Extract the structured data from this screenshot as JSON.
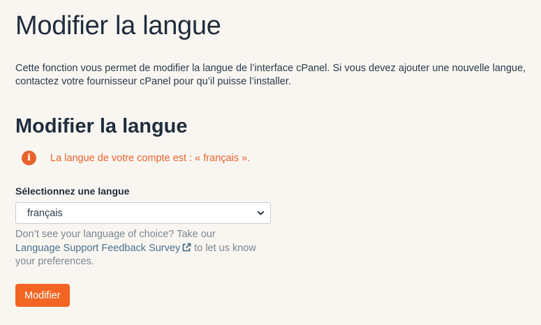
{
  "page": {
    "title": "Modifier la langue",
    "intro": "Cette fonction vous permet de modifier la langue de l’interface cPanel. Si vous devez ajouter une nouvelle langue, contactez votre fournisseur cPanel pour qu’il puisse l’installer."
  },
  "section": {
    "title": "Modifier la langue",
    "notice": "La langue de votre compte est : « français ».",
    "notice_icon": "info-icon"
  },
  "form": {
    "select_label": "Sélectionnez une langue",
    "selected_language": "français",
    "help_prefix": "Don’t see your language of choice? Take our ",
    "help_link": "Language Support Feedback Survey",
    "help_suffix": "to let us know your preferences.",
    "submit_label": "Modifier"
  },
  "colors": {
    "background": "#f9f6f1",
    "accent": "#f26522",
    "notice": "#e8622c",
    "link": "#4a6f8c"
  }
}
